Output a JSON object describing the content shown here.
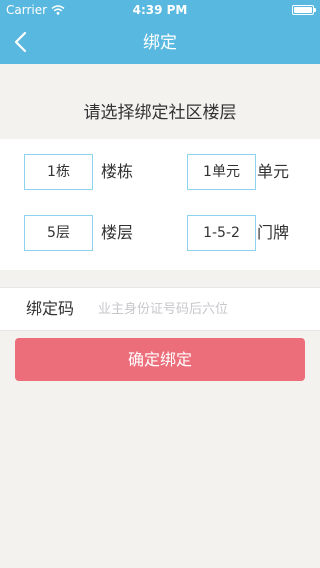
{
  "status_bar": {
    "carrier": "Carrier",
    "time": "4:39 PM",
    "battery_level": 1.0
  },
  "nav": {
    "title": "绑定"
  },
  "prompt": "请选择绑定社区楼层",
  "selectors": {
    "building": {
      "value": "1栋",
      "unit": "楼栋"
    },
    "unit_no": {
      "value": "1单元",
      "unit": "单元"
    },
    "floor": {
      "value": "5层",
      "unit": "楼层"
    },
    "door": {
      "value": "1-5-2",
      "unit": "门牌"
    }
  },
  "binding_code": {
    "label": "绑定码",
    "placeholder": "业主身份证号码后六位",
    "value": ""
  },
  "confirm_button": {
    "label": "确定绑定"
  },
  "colors": {
    "header": "#59b8df",
    "background": "#f4f2ef",
    "field_border": "#8ed3ee",
    "button": "#ec6e7a"
  }
}
